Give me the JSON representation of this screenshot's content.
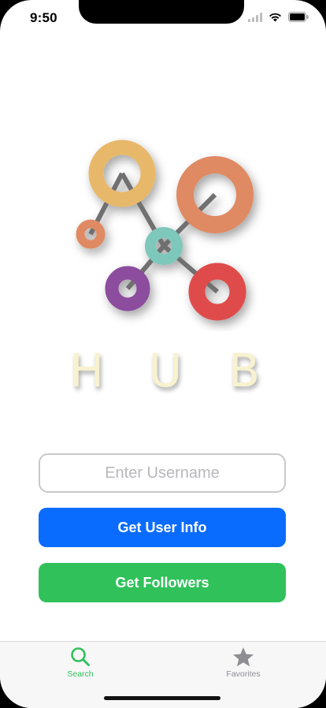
{
  "status_bar": {
    "time": "9:50",
    "icons": [
      "cellular-signal-icon",
      "wifi-icon",
      "battery-icon"
    ]
  },
  "logo": {
    "word_letters": [
      "H",
      "U",
      "B"
    ],
    "colors": {
      "yellow_ring": "#e8b86a",
      "orange_ring_large": "#df8a62",
      "orange_ring_small": "#df8a62",
      "teal_node": "#7ec8bb",
      "purple_ring": "#8c4d9e",
      "red_ring": "#df4b4b",
      "connector": "#707070",
      "letters": "#f8f2cf"
    }
  },
  "search": {
    "placeholder": "Enter Username",
    "value": ""
  },
  "buttons": {
    "get_user_info": "Get User Info",
    "get_followers": "Get Followers"
  },
  "colors": {
    "primary_blue": "#0a6cff",
    "primary_green": "#30c15a",
    "tab_active": "#30c15a",
    "tab_inactive": "#8e8e93"
  },
  "tab_bar": {
    "items": [
      {
        "label": "Search",
        "icon": "magnifying-glass-icon",
        "active": true
      },
      {
        "label": "Favorites",
        "icon": "star-icon",
        "active": false
      }
    ]
  }
}
